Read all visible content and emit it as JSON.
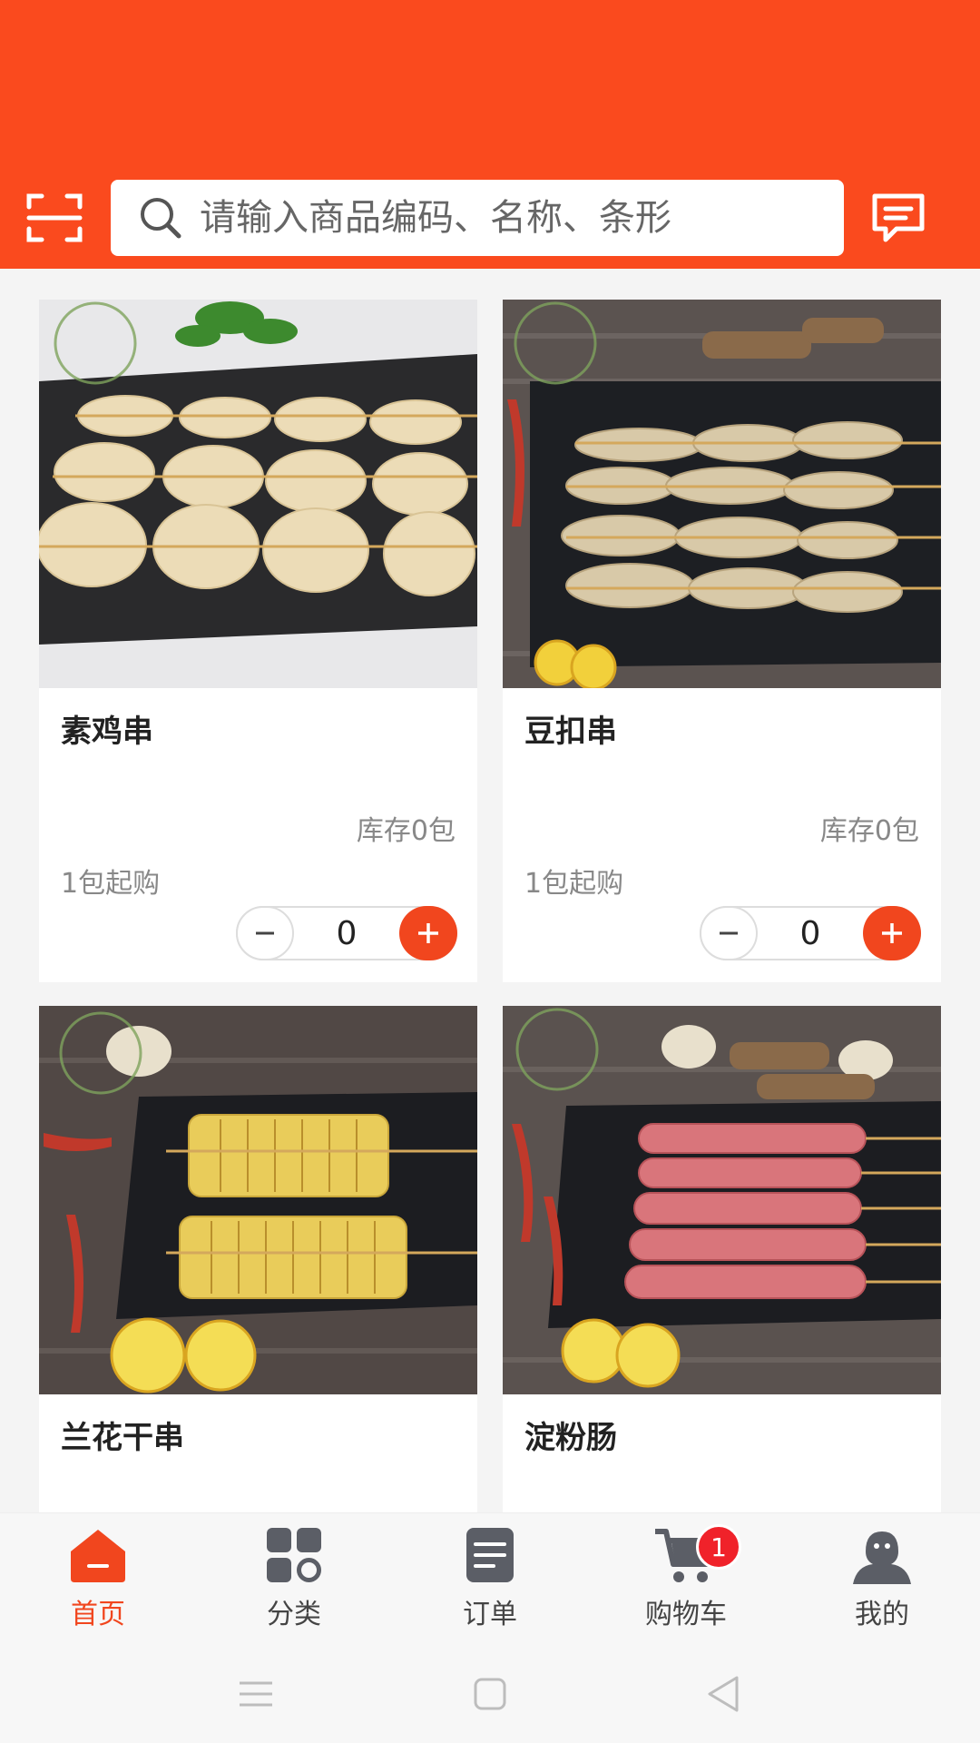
{
  "colors": {
    "accent": "#fa4a1e",
    "plus": "#f1461e",
    "badge": "#f0222a"
  },
  "search": {
    "placeholder": "请输入商品编码、名称、条形"
  },
  "products": [
    {
      "name": "素鸡串",
      "stock": "库存0包",
      "moq": "1包起购",
      "qty": "0",
      "image": "sliced tofu rounds on skewers"
    },
    {
      "name": "豆扣串",
      "stock": "库存0包",
      "moq": "1包起购",
      "qty": "0",
      "image": "knotted tofu skin on skewers"
    },
    {
      "name": "兰花干串",
      "image": "orchid dried tofu on skewers"
    },
    {
      "name": "淀粉肠",
      "image": "starch sausages on skewers"
    }
  ],
  "tabbar": {
    "items": [
      {
        "label": "首页",
        "icon": "home-icon",
        "active": true
      },
      {
        "label": "分类",
        "icon": "category-icon"
      },
      {
        "label": "订单",
        "icon": "orders-icon"
      },
      {
        "label": "购物车",
        "icon": "cart-icon",
        "badge": "1"
      },
      {
        "label": "我的",
        "icon": "user-icon"
      }
    ]
  },
  "system_nav": [
    "menu-icon",
    "home-square-icon",
    "back-triangle-icon"
  ]
}
